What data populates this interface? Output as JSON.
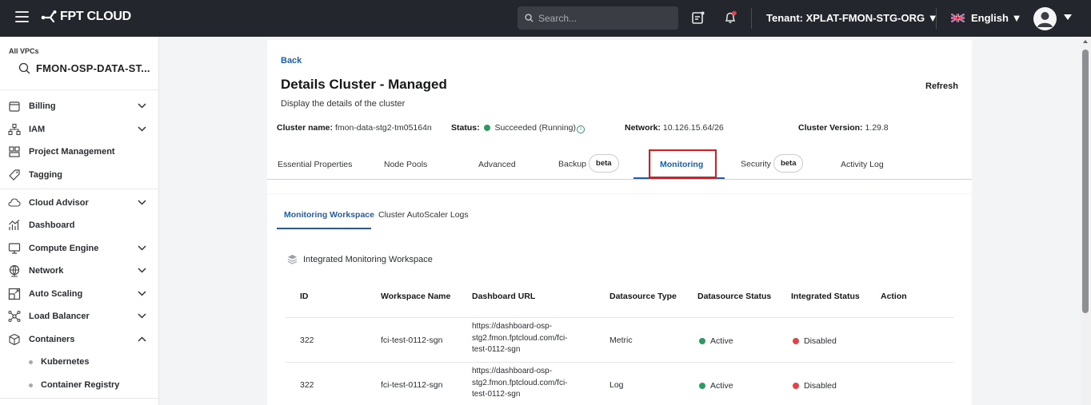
{
  "topbar": {
    "logo_text": "FPT CLOUD",
    "search_placeholder": "Search...",
    "tenant_label": "Tenant: XPLAT-FMON-STG-ORG",
    "language": "English"
  },
  "sidebar": {
    "vpc_label": "All VPCs",
    "vpc_name": "FMON-OSP-DATA-ST...",
    "items": [
      {
        "label": "Billing",
        "icon": "billing-icon",
        "expandable": true
      },
      {
        "label": "IAM",
        "icon": "iam-icon",
        "expandable": true
      },
      {
        "label": "Project Management",
        "icon": "project-icon",
        "expandable": false
      },
      {
        "label": "Tagging",
        "icon": "tag-icon",
        "expandable": false
      },
      {
        "label": "Cloud Advisor",
        "icon": "cloud-icon",
        "expandable": true
      },
      {
        "label": "Dashboard",
        "icon": "dashboard-icon",
        "expandable": false
      },
      {
        "label": "Compute Engine",
        "icon": "monitor-icon",
        "expandable": true
      },
      {
        "label": "Network",
        "icon": "globe-icon",
        "expandable": true
      },
      {
        "label": "Auto Scaling",
        "icon": "scaling-icon",
        "expandable": true
      },
      {
        "label": "Load Balancer",
        "icon": "loadbalancer-icon",
        "expandable": true
      },
      {
        "label": "Containers",
        "icon": "cube-icon",
        "expandable": true,
        "expanded": true
      }
    ],
    "sub_items": [
      "Kubernetes",
      "Container Registry"
    ]
  },
  "page": {
    "back": "Back",
    "title": "Details Cluster - Managed",
    "subtitle": "Display the details of the cluster",
    "refresh": "Refresh",
    "cluster_name_label": "Cluster name:",
    "cluster_name": "fmon-data-stg2-tm05164n",
    "status_label": "Status:",
    "status": "Succeeded (Running)",
    "network_label": "Network:",
    "network": "10.126.15.64/26",
    "version_label": "Cluster Version:",
    "version": "1.29.8"
  },
  "tabs": [
    {
      "label": "Essential Properties"
    },
    {
      "label": "Node Pools"
    },
    {
      "label": "Advanced"
    },
    {
      "label": "Backup",
      "badge": "beta"
    },
    {
      "label": "Monitoring",
      "active": true
    },
    {
      "label": "Security",
      "badge": "beta"
    },
    {
      "label": "Activity Log"
    }
  ],
  "subtabs": [
    "Monitoring Workspace",
    "Cluster AutoScaler Logs"
  ],
  "workspace": {
    "heading": "Integrated Monitoring Workspace",
    "columns": [
      "ID",
      "Workspace Name",
      "Dashboard URL",
      "Datasource Type",
      "Datasource Status",
      "Integrated Status",
      "Action"
    ],
    "rows": [
      {
        "id": "322",
        "name": "fci-test-0112-sgn",
        "url_lines": [
          "https://dashboard-osp-",
          "stg2.fmon.fptcloud.com/fci-",
          "test-0112-sgn"
        ],
        "type": "Metric",
        "ds_status": "Active",
        "int_status": "Disabled"
      },
      {
        "id": "322",
        "name": "fci-test-0112-sgn",
        "url_lines": [
          "https://dashboard-osp-",
          "stg2.fmon.fptcloud.com/fci-",
          "test-0112-sgn"
        ],
        "type": "Log",
        "ds_status": "Active",
        "int_status": "Disabled"
      }
    ]
  },
  "colors": {
    "accent": "#1f5fa8",
    "active": "#2d9a63",
    "disabled": "#e0444b",
    "highlight": "#e3171e"
  }
}
